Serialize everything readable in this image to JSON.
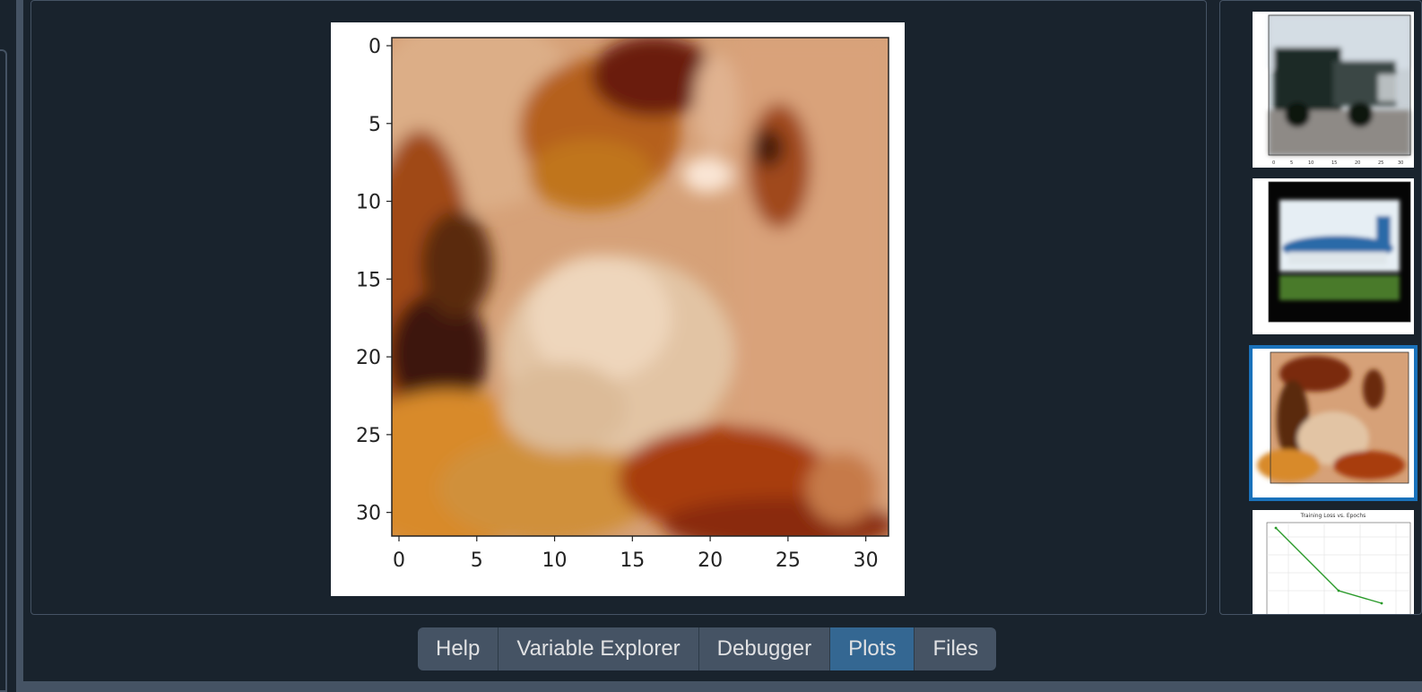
{
  "plot": {
    "image_title": "",
    "x_ticks": [
      "0",
      "5",
      "10",
      "15",
      "20",
      "25",
      "30"
    ],
    "y_ticks": [
      "0",
      "5",
      "10",
      "15",
      "20",
      "25",
      "30"
    ]
  },
  "thumbnails": [
    {
      "subject": "truck",
      "selected": false
    },
    {
      "subject": "airplane",
      "selected": false
    },
    {
      "subject": "dog",
      "selected": true
    },
    {
      "subject": "line-plot",
      "selected": false,
      "title": "Training Loss vs. Epochs"
    }
  ],
  "tabs": [
    {
      "label": "Help",
      "active": false
    },
    {
      "label": "Variable Explorer",
      "active": false
    },
    {
      "label": "Debugger",
      "active": false
    },
    {
      "label": "Plots",
      "active": true
    },
    {
      "label": "Files",
      "active": false
    }
  ],
  "colors": {
    "background": "#19232d",
    "border": "#455364",
    "accent": "#346792",
    "selected_outline": "#1a72bb",
    "text": "#e0e1e3"
  }
}
